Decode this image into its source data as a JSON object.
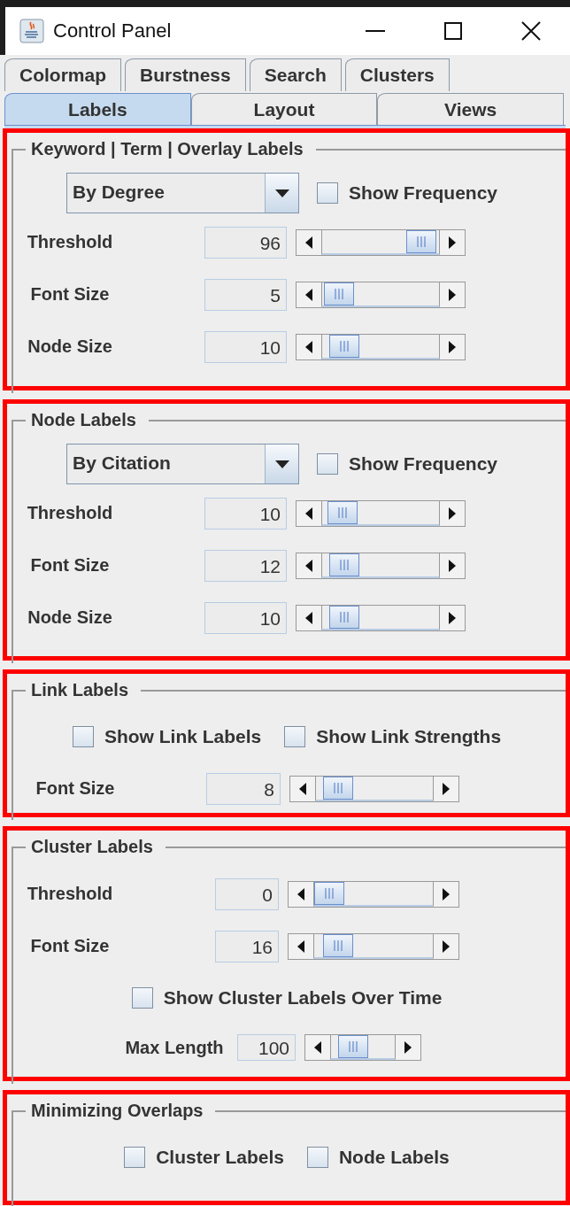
{
  "window": {
    "title": "Control Panel"
  },
  "tab_rows": [
    [
      {
        "label": "Colormap",
        "selected": false
      },
      {
        "label": "Burstness",
        "selected": false
      },
      {
        "label": "Search",
        "selected": false
      },
      {
        "label": "Clusters",
        "selected": false
      }
    ],
    [
      {
        "label": "Labels",
        "selected": true
      },
      {
        "label": "Layout",
        "selected": false
      },
      {
        "label": "Views",
        "selected": false
      }
    ]
  ],
  "sections": [
    {
      "title": "Keyword | Term | Overlay Labels",
      "items": [
        {
          "kind": "combo",
          "value": "By Degree",
          "check_label": "Show Frequency",
          "checked": false
        },
        {
          "kind": "slider",
          "label": "Threshold",
          "value": "96"
        },
        {
          "kind": "slider",
          "label": "Font Size",
          "value": "5"
        },
        {
          "kind": "slider",
          "label": "Node Size",
          "value": "10"
        }
      ]
    },
    {
      "title": "Node Labels",
      "items": [
        {
          "kind": "combo",
          "value": "By Citation",
          "check_label": "Show Frequency",
          "checked": false
        },
        {
          "kind": "slider",
          "label": "Threshold",
          "value": "10"
        },
        {
          "kind": "slider",
          "label": "Font Size",
          "value": "12"
        },
        {
          "kind": "slider",
          "label": "Node Size",
          "value": "10"
        }
      ]
    },
    {
      "title": "Link Labels",
      "items": [
        {
          "kind": "checks",
          "boxes": [
            {
              "label": "Show Link Labels",
              "checked": false
            },
            {
              "label": "Show Link Strengths",
              "checked": false
            }
          ]
        },
        {
          "kind": "slider",
          "label": "Font Size",
          "value": "8"
        }
      ]
    },
    {
      "title": "Cluster Labels",
      "items": [
        {
          "kind": "slider",
          "label": "Threshold",
          "value": "0"
        },
        {
          "kind": "slider",
          "label": "Font Size",
          "value": "16"
        },
        {
          "kind": "checks",
          "boxes": [
            {
              "label": "Show Cluster Labels Over Time",
              "checked": false
            }
          ]
        },
        {
          "kind": "compact_slider",
          "label": "Max Length",
          "value": "100"
        }
      ]
    },
    {
      "title": "Minimizing Overlaps",
      "items": [
        {
          "kind": "checks",
          "boxes": [
            {
              "label": "Cluster Labels",
              "checked": false
            },
            {
              "label": "Node Labels",
              "checked": false
            }
          ]
        }
      ]
    }
  ]
}
